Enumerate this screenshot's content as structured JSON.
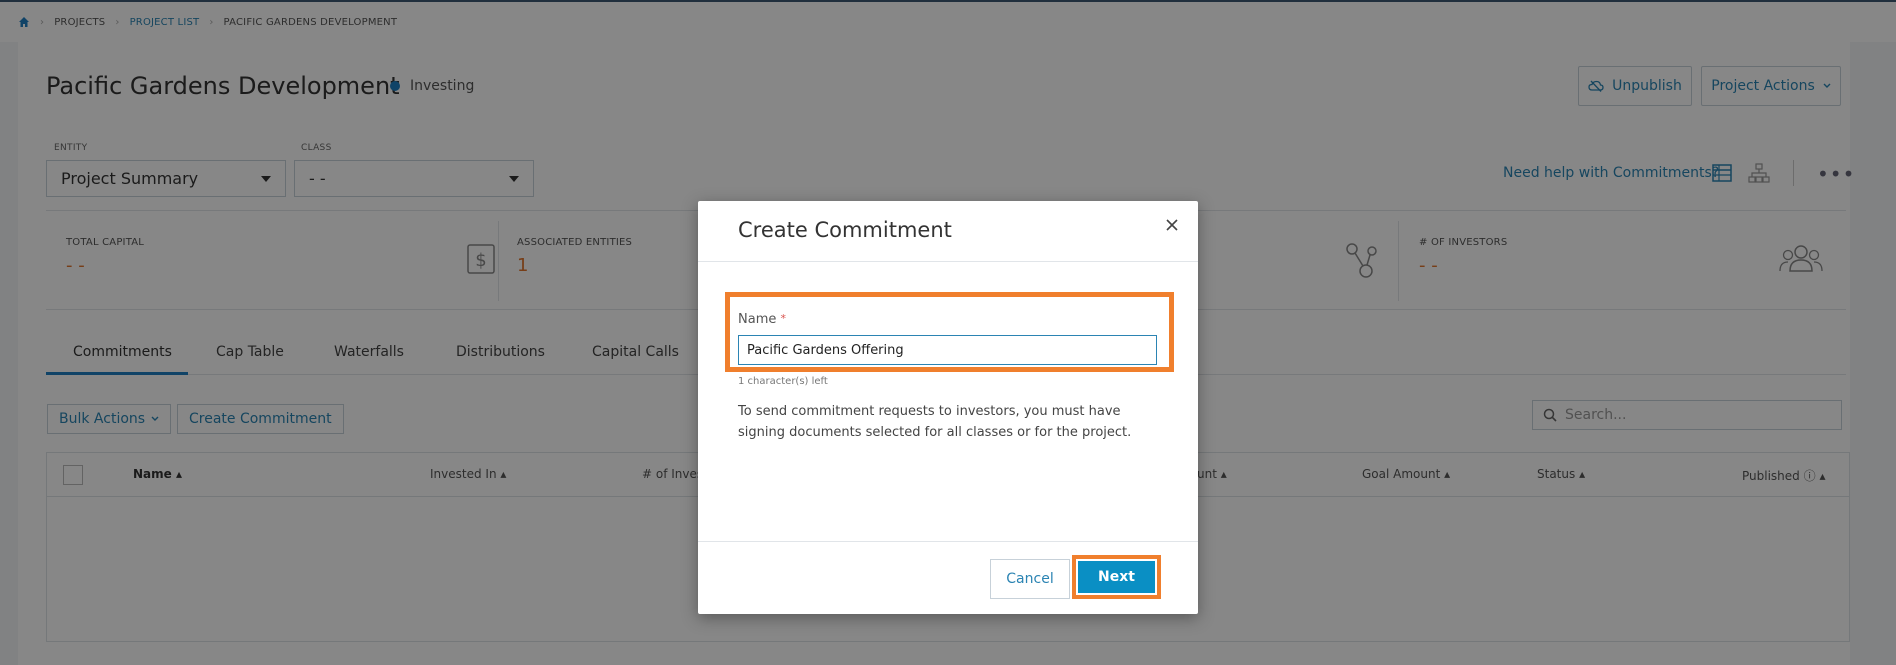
{
  "breadcrumb": {
    "home_icon": "home-icon",
    "items": [
      "PROJECTS",
      "PROJECT LIST",
      "PACIFIC GARDENS DEVELOPMENT"
    ]
  },
  "project": {
    "title": "Pacific Gardens Development",
    "status": "Investing",
    "status_color": "#1f7fc2"
  },
  "header_actions": {
    "unpublish_label": "Unpublish",
    "project_actions_label": "Project Actions"
  },
  "filters": {
    "entity_label": "ENTITY",
    "entity_value": "Project Summary",
    "class_label": "CLASS",
    "class_value": "- -"
  },
  "help_link": "Need help with Commitments?",
  "stats": [
    {
      "label": "TOTAL CAPITAL",
      "value": "- -"
    },
    {
      "label": "ASSOCIATED ENTITIES",
      "value": "1"
    },
    {
      "label": "# OF INVESTORS",
      "value": "- -"
    }
  ],
  "tabs": [
    "Commitments",
    "Cap Table",
    "Waterfalls",
    "Distributions",
    "Capital Calls"
  ],
  "toolbar": {
    "bulk_actions_label": "Bulk Actions",
    "create_commitment_label": "Create Commitment",
    "search_placeholder": "Search..."
  },
  "table": {
    "columns": [
      "Name",
      "Invested In",
      "# of Inves",
      "unt",
      "Goal Amount",
      "Status",
      "Published"
    ]
  },
  "modal": {
    "title": "Create Commitment",
    "name_label": "Name",
    "required_mark": "*",
    "name_value": "Pacific Gardens Offering",
    "chars_left": "1 character(s) left",
    "description": "To send commitment requests to investors, you must have signing documents selected for all classes or for the project.",
    "cancel_label": "Cancel",
    "next_label": "Next"
  },
  "colors": {
    "accent": "#2b84b3",
    "primary_button": "#0a8fc4",
    "highlight": "#f07f2d",
    "stat_value": "#e0762f"
  }
}
